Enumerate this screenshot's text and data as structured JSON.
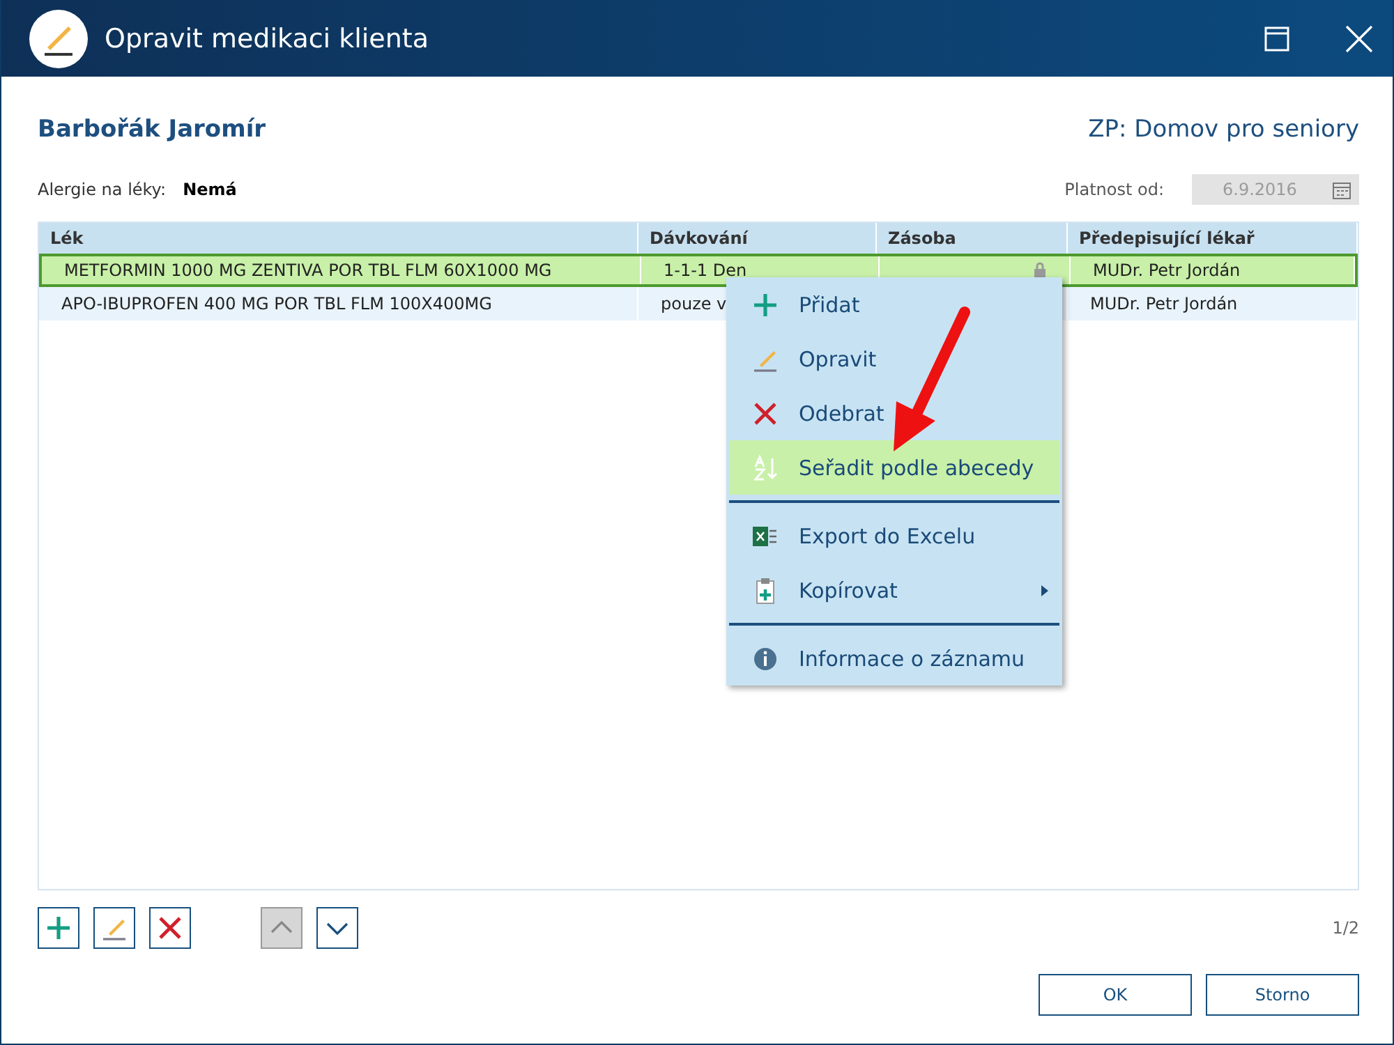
{
  "window": {
    "title": "Opravit medikaci klienta"
  },
  "client": {
    "name": "Barbořák Jaromír",
    "facility": "ZP: Domov pro seniory"
  },
  "allergy": {
    "label": "Alergie na léky:",
    "value": "Nemá"
  },
  "validity": {
    "label": "Platnost od:",
    "value": "6.9.2016",
    "disabled": true
  },
  "table": {
    "columns": [
      "Lék",
      "Dávkování",
      "Zásoba",
      "Předepisující lékař"
    ],
    "rows": [
      {
        "cells": [
          "METFORMIN 1000 MG ZENTIVA POR TBL FLM 60X1000 MG",
          "1-1-1 Den",
          "",
          "MUDr. Petr Jordán"
        ],
        "locked": true,
        "selected": true
      },
      {
        "cells": [
          "APO-IBUPROFEN 400 MG POR TBL FLM 100X400MG",
          "pouze v",
          "",
          "MUDr. Petr Jordán"
        ],
        "selected": false
      }
    ]
  },
  "context_menu": {
    "groups": [
      [
        {
          "label": "Přidat",
          "kind": "add",
          "selected": false,
          "submenu": false
        },
        {
          "label": "Opravit",
          "kind": "edit",
          "selected": false,
          "submenu": false
        },
        {
          "label": "Odebrat",
          "kind": "remove",
          "selected": false,
          "submenu": false
        },
        {
          "label": "Seřadit podle abecedy",
          "kind": "sort",
          "selected": true,
          "submenu": false
        }
      ],
      [
        {
          "label": "Export do Excelu",
          "kind": "excel",
          "selected": false,
          "submenu": false
        },
        {
          "label": "Kopírovat",
          "kind": "copy",
          "selected": false,
          "submenu": true
        }
      ],
      [
        {
          "label": "Informace o záznamu",
          "kind": "info",
          "selected": false,
          "submenu": false
        }
      ]
    ]
  },
  "toolbar": [
    {
      "kind": "add",
      "disabled": false
    },
    {
      "kind": "edit",
      "disabled": false
    },
    {
      "kind": "remove",
      "disabled": false
    },
    {
      "kind": "up",
      "disabled": true
    },
    {
      "kind": "down",
      "disabled": false
    }
  ],
  "pager": "1/2",
  "buttons": [
    "OK",
    "Storno"
  ]
}
